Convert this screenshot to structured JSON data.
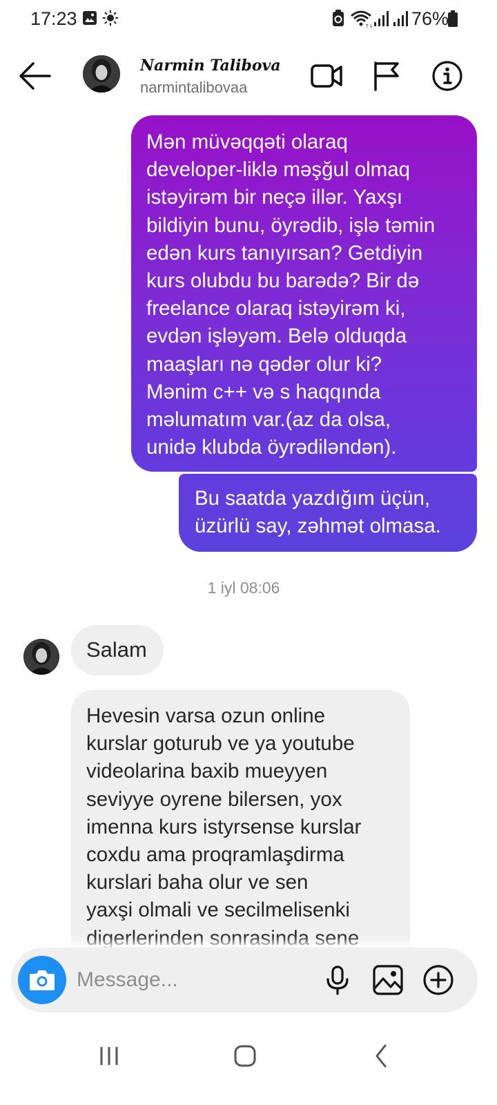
{
  "status_bar": {
    "time": "17:23",
    "battery_percent": "76%",
    "icons": [
      "gallery-icon",
      "brightness-icon",
      "recycle-icon",
      "wifi-icon",
      "signal-icon",
      "signal-icon",
      "battery-icon"
    ]
  },
  "header": {
    "display_name": "Narmin Talibova",
    "username": "narmintalibovaa",
    "icons": [
      "back-arrow-icon",
      "video-call-icon",
      "flag-icon",
      "info-icon"
    ]
  },
  "messages": [
    {
      "direction": "outgoing",
      "lines": [
        "Mən müvəqqəti olaraq",
        "developer-liklə məşğul olmaq",
        "istəyirəm bir neçə illər. Yaxşı",
        "bildiyin bunu, öyrədib, işlə təmin",
        "edən kurs tanıyırsan? Getdiyin",
        "kurs olubdu bu barədə? Bir də",
        "freelance olaraq istəyirəm ki,",
        "evdən işləyəm. Belə olduqda",
        "maaşları nə qədər olur ki?",
        "Mənim c++ və s haqqında",
        "məlumatım var.(az da olsa,",
        "unidə klubda öyrədiləndən)."
      ]
    },
    {
      "direction": "outgoing",
      "lines": [
        "Bu saatda yazdığım üçün,",
        "üzürlü say, zəhmət olmasa."
      ]
    },
    {
      "direction": "incoming",
      "lines": [
        "Salam"
      ]
    },
    {
      "direction": "incoming",
      "lines": [
        "Hevesin varsa ozun online",
        "kurslar goturub ve ya youtube",
        "videolarina baxib mueyyen",
        "seviyye oyrene bilersen, yox",
        "imenna kurs istyrsense kurslar",
        "coxdu ama proqramlaşdirma",
        "kurslari baha olur ve sen",
        "yaxşi olmali ve secilmelisenki",
        "digerlerinden sonrasinda sene"
      ]
    }
  ],
  "timestamp": "1 iyl 08:06",
  "composer": {
    "placeholder": "Message...",
    "icons": [
      "camera-icon",
      "microphone-icon",
      "image-icon",
      "add-icon"
    ]
  },
  "nav_bar": {
    "icons": [
      "recent-apps-icon",
      "home-icon",
      "back-icon"
    ]
  },
  "colors": {
    "outgoing_gradient_top": "#9810c6",
    "outgoing_gradient_bottom": "#5b42dd",
    "incoming_bubble": "#efefef",
    "camera_button": "#1d8ff3",
    "timestamp_text": "#8e8e8e"
  }
}
